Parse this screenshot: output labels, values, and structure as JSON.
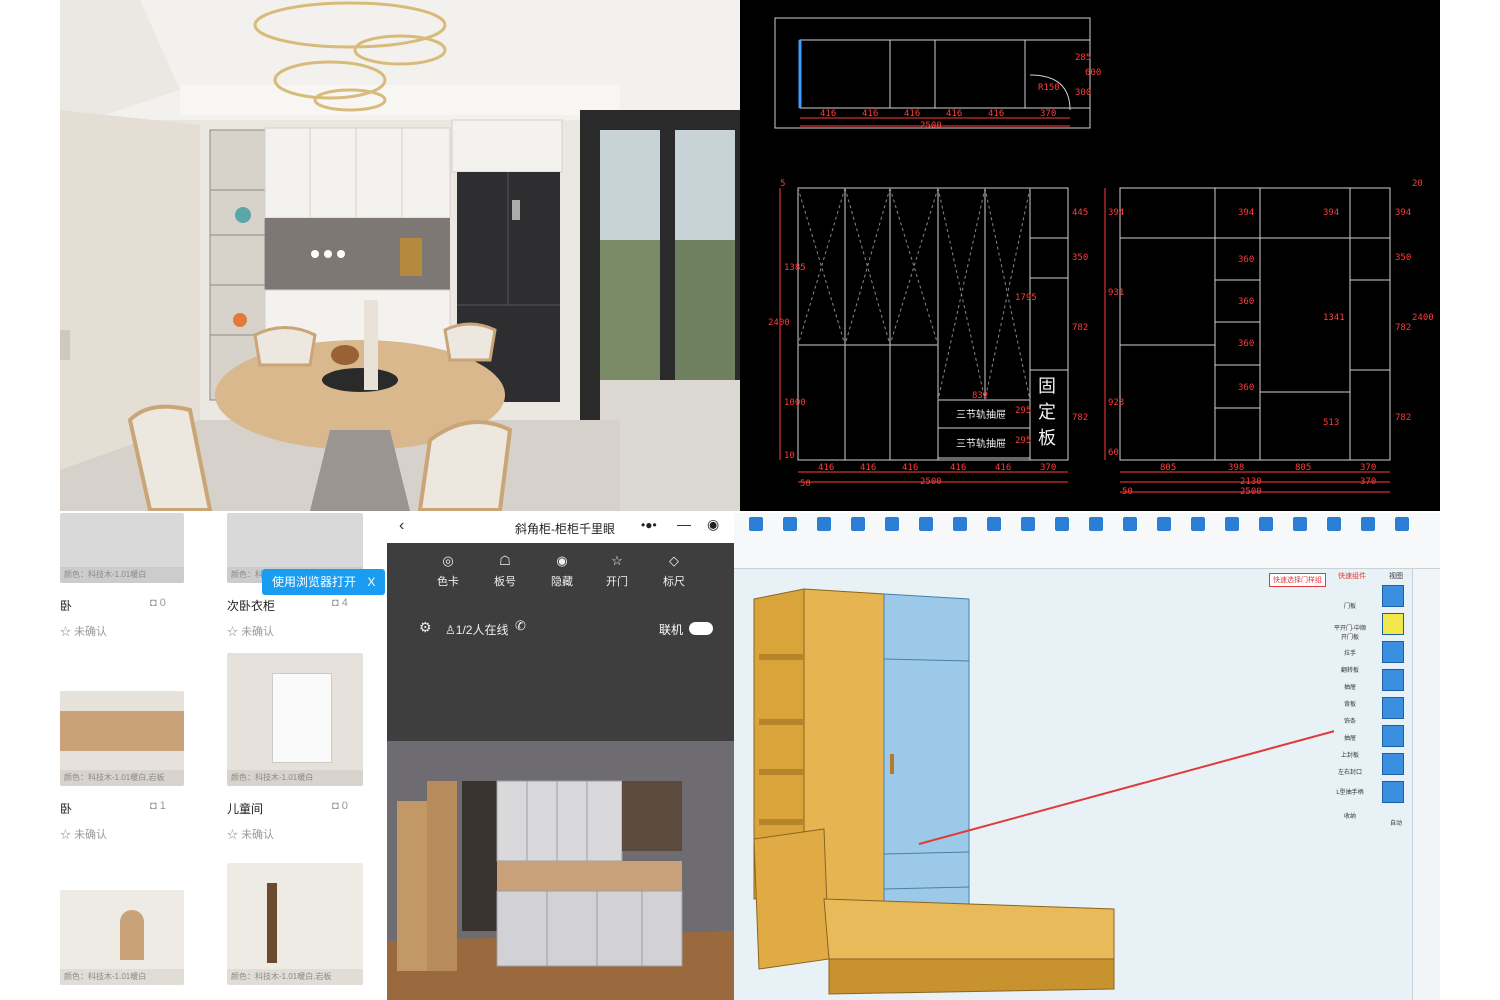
{
  "cad": {
    "top_dims": [
      "416",
      "416",
      "416",
      "416",
      "416",
      "370"
    ],
    "top_total": "2500",
    "top_side_dims": [
      "285",
      "600",
      "300"
    ],
    "radius_label": "R150",
    "left_bottom_dims": [
      "416",
      "416",
      "416",
      "416",
      "416",
      "370"
    ],
    "left_total": "2500",
    "left_heights": [
      "1385",
      "2400",
      "1000",
      "10"
    ],
    "left_mid_dims": [
      "445",
      "350",
      "1795",
      "782",
      "295",
      "295",
      "782"
    ],
    "drawer_width": "832",
    "drawer_labels": [
      "三节轨抽屉",
      "三节轨抽屉"
    ],
    "fixed_board": [
      "固",
      "定",
      "板"
    ],
    "right_bottom_dims": [
      "805",
      "398",
      "805",
      "370"
    ],
    "right_totals": [
      "2130",
      "2500",
      "370"
    ],
    "right_heights": [
      "394",
      "931",
      "923",
      "60"
    ],
    "right_mid_dims": [
      "394",
      "350",
      "360",
      "360",
      "360",
      "360",
      "1341",
      "513",
      "782",
      "2400",
      "782",
      "394"
    ],
    "small_left_dims": [
      "50",
      "50",
      "20",
      "5"
    ]
  },
  "gallery": {
    "open_browser": "使用浏览器打开",
    "open_browser_close": "X",
    "rooms": [
      {
        "name": "卧",
        "count": "0",
        "status": "未确认",
        "caption": "颜色：科技木-1.01暖白"
      },
      {
        "name": "次卧衣柜",
        "count": "4",
        "status": "未确认",
        "caption": "颜色：科技木-1.01暖白"
      },
      {
        "name": "卧",
        "count": "1",
        "status": "未确认",
        "caption": "颜色：科技木-1.01暖白,岩板"
      },
      {
        "name": "儿童间",
        "count": "0",
        "status": "未确认",
        "caption": "颜色：科技木-1.01暖白"
      },
      {
        "name": "",
        "count": "",
        "status": "",
        "caption": "颜色：科技木-1.01暖白"
      },
      {
        "name": "",
        "count": "",
        "status": "",
        "caption": "颜色：科技木-1.01暖白,岩板"
      }
    ]
  },
  "viewer": {
    "title": "斜角柜-柜柜千里眼",
    "tools": [
      "色卡",
      "板号",
      "隐藏",
      "开门",
      "标尺"
    ],
    "online": "1/2人在线",
    "connect": "联机"
  },
  "software": {
    "red_label_1": "快速选择门样组",
    "red_label_2": "快速组件",
    "panel_title": "视图",
    "side_items": [
      "门板",
      "平开门-中顺开门板",
      "拉手",
      "翻转板",
      "抽屉",
      "背板",
      "饰条",
      "抽屉",
      "上封板",
      "左右封口",
      "L型抽手柄",
      "收纳"
    ],
    "auto_label": "自动"
  },
  "colors": {
    "cad_dim": "#ff3b3b",
    "cad_line": "#d0d0d0",
    "wood": "#e2b04a",
    "door_blue": "#8fc3e6",
    "accent": "#1a9df0"
  }
}
